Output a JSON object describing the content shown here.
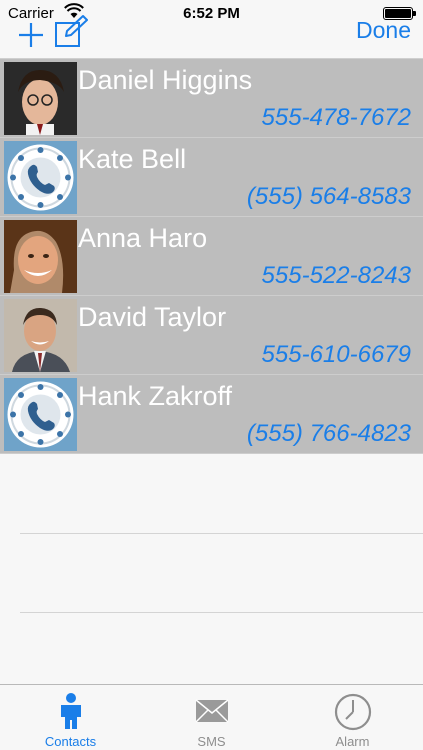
{
  "status_bar": {
    "carrier": "Carrier",
    "time": "6:52 PM"
  },
  "nav_bar": {
    "done_label": "Done",
    "add_icon": "plus-icon",
    "compose_icon": "compose-icon"
  },
  "contacts": [
    {
      "name": "Daniel Higgins",
      "phone": "555-478-7672",
      "avatar": "photo"
    },
    {
      "name": "Kate Bell",
      "phone": "(555) 564-8583",
      "avatar": "phone-placeholder"
    },
    {
      "name": "Anna Haro",
      "phone": "555-522-8243",
      "avatar": "photo"
    },
    {
      "name": "David Taylor",
      "phone": "555-610-6679",
      "avatar": "photo"
    },
    {
      "name": "Hank Zakroff",
      "phone": "(555) 766-4823",
      "avatar": "phone-placeholder"
    }
  ],
  "tab_bar": {
    "tabs": [
      {
        "label": "Contacts",
        "icon": "person-icon",
        "active": true
      },
      {
        "label": "SMS",
        "icon": "envelope-icon",
        "active": false
      },
      {
        "label": "Alarm",
        "icon": "clock-icon",
        "active": false
      }
    ]
  },
  "colors": {
    "accent": "#1a7ee8",
    "row_background": "#bdbdbd",
    "name_text": "#ffffff"
  }
}
